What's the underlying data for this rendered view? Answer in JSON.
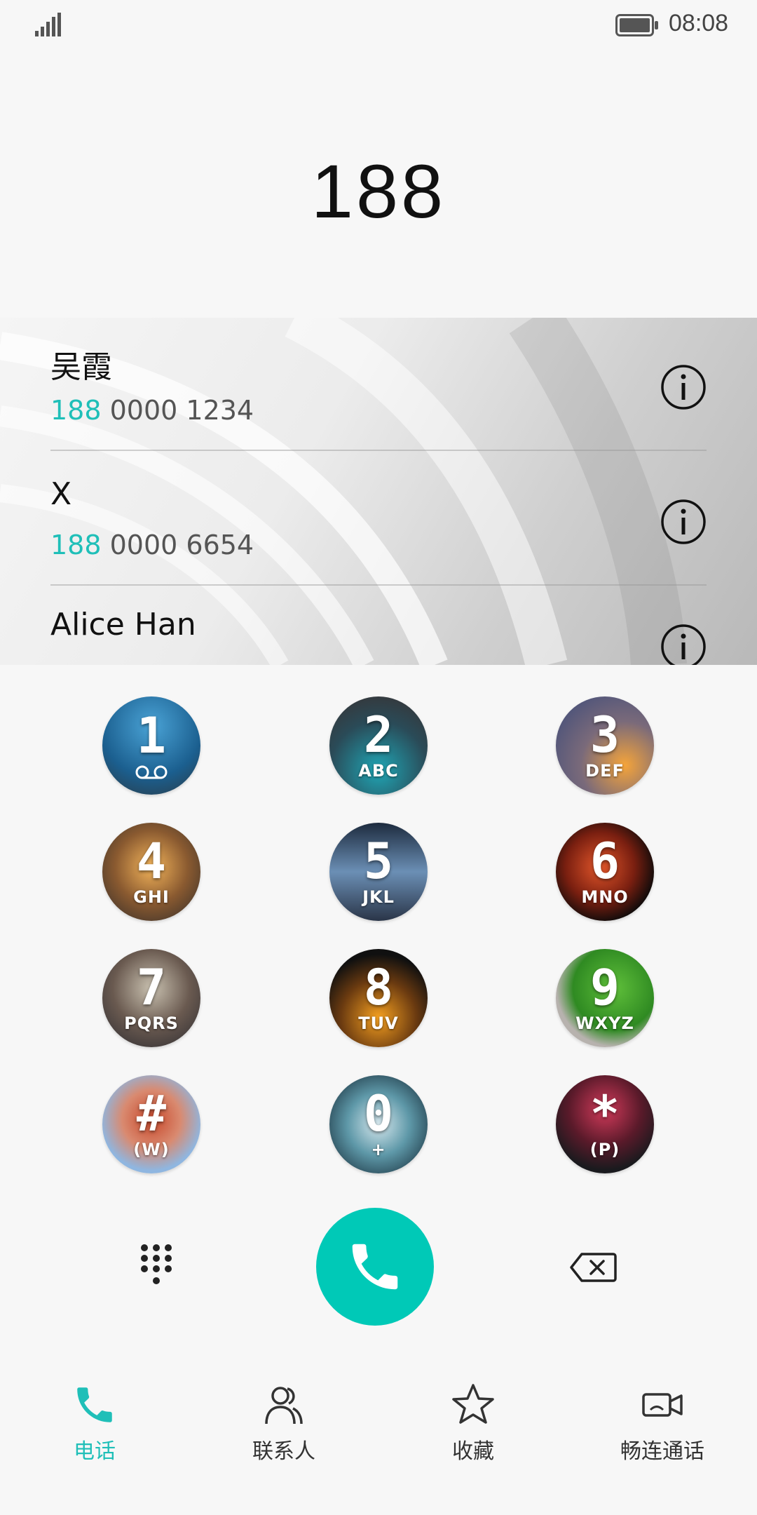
{
  "status_bar": {
    "time": "08:08",
    "signal_icon": "signal-bars-icon",
    "battery_icon": "battery-full-icon"
  },
  "dialer": {
    "input_number": "188"
  },
  "results": [
    {
      "name": "吴霞",
      "number_match": "188",
      "number_rest": " 0000 1234"
    },
    {
      "name": "X",
      "number_match": "188",
      "number_rest": " 0000 6654"
    },
    {
      "name": "Alice Han",
      "number_match": "",
      "number_rest": ""
    }
  ],
  "keypad": {
    "keys": [
      {
        "digit": "1",
        "letters": "",
        "icon": "voicemail-icon"
      },
      {
        "digit": "2",
        "letters": "ABC"
      },
      {
        "digit": "3",
        "letters": "DEF"
      },
      {
        "digit": "4",
        "letters": "GHI"
      },
      {
        "digit": "5",
        "letters": "JKL"
      },
      {
        "digit": "6",
        "letters": "MNO"
      },
      {
        "digit": "7",
        "letters": "PQRS"
      },
      {
        "digit": "8",
        "letters": "TUV"
      },
      {
        "digit": "9",
        "letters": "WXYZ"
      },
      {
        "digit": "#",
        "letters": "(W)"
      },
      {
        "digit": "0",
        "letters": "+"
      },
      {
        "digit": "*",
        "letters": "(P)"
      }
    ]
  },
  "actions": {
    "dialpad_icon": "dialpad-grid-icon",
    "call_icon": "phone-icon",
    "backspace_icon": "backspace-icon"
  },
  "tabs": [
    {
      "label": "电话",
      "icon": "phone-icon",
      "active": true
    },
    {
      "label": "联系人",
      "icon": "contacts-icon",
      "active": false
    },
    {
      "label": "收藏",
      "icon": "star-icon",
      "active": false
    },
    {
      "label": "畅连通话",
      "icon": "video-call-icon",
      "active": false
    }
  ],
  "colors": {
    "accent": "#00c9b7",
    "match_text": "#1fbfb8"
  }
}
